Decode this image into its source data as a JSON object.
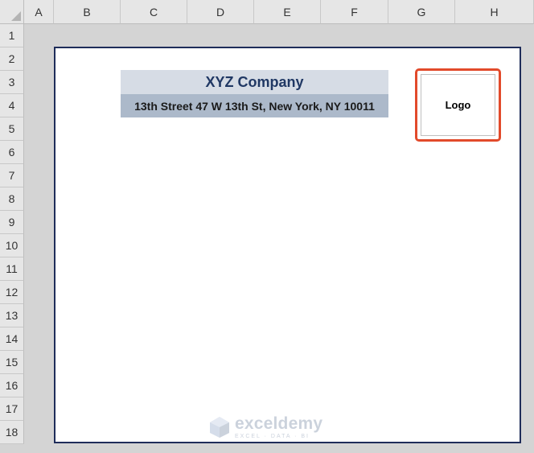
{
  "spreadsheet": {
    "columns": [
      "A",
      "B",
      "C",
      "D",
      "E",
      "F",
      "G",
      "H"
    ],
    "rows": [
      "1",
      "2",
      "3",
      "4",
      "5",
      "6",
      "7",
      "8",
      "9",
      "10",
      "11",
      "12",
      "13",
      "14",
      "15",
      "16",
      "17",
      "18"
    ]
  },
  "letterhead": {
    "company_name": "XYZ Company",
    "address": "13th Street 47 W 13th St, New York, NY 10011",
    "logo_label": "Logo"
  },
  "watermark": {
    "brand": "exceldemy",
    "tagline": "EXCEL · DATA · BI"
  },
  "colors": {
    "title_fill": "#d6dce5",
    "title_text": "#203864",
    "address_fill": "#acb9ca",
    "highlight_border": "#e24a2b",
    "page_border": "#1f2d5a"
  }
}
